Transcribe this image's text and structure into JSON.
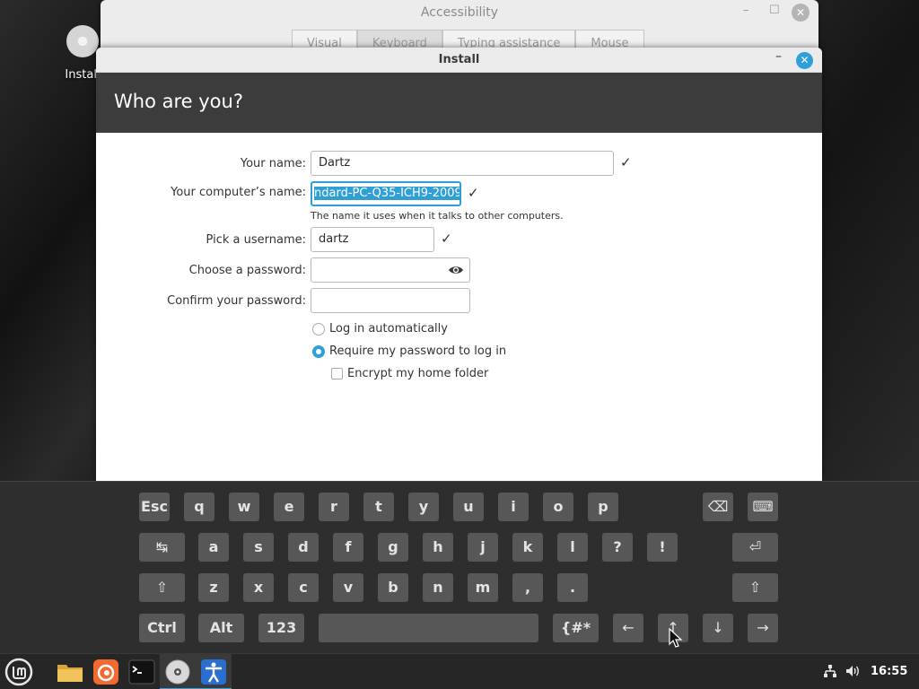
{
  "desktop": {
    "icon_label": "Install"
  },
  "accessibility": {
    "title": "Accessibility",
    "tabs": [
      "Visual",
      "Keyboard",
      "Typing assistance",
      "Mouse"
    ],
    "active_tab": "Keyboard"
  },
  "install": {
    "title": "Install",
    "heading": "Who are you?",
    "form": {
      "name_label": "Your name:",
      "name_value": "Dartz",
      "computer_label": "Your computer’s name:",
      "computer_value": "ndard-PC-Q35-ICH9-2009",
      "computer_hint": "The name it uses when it talks to other computers.",
      "username_label": "Pick a username:",
      "username_value": "dartz",
      "password_label": "Choose a password:",
      "password_value": "",
      "confirm_label": "Confirm your password:",
      "confirm_value": "",
      "login_auto": "Log in automatically",
      "login_require": "Require my password to log in",
      "encrypt": "Encrypt my home folder"
    }
  },
  "keyboard": {
    "row1": [
      "Esc",
      "q",
      "w",
      "e",
      "r",
      "t",
      "y",
      "u",
      "i",
      "o",
      "p"
    ],
    "row2": [
      "a",
      "s",
      "d",
      "f",
      "g",
      "h",
      "j",
      "k",
      "l",
      "?",
      "!"
    ],
    "row3": [
      "z",
      "x",
      "c",
      "v",
      "b",
      "n",
      "m",
      ",",
      "."
    ],
    "row4": {
      "ctrl": "Ctrl",
      "alt": "Alt",
      "num": "123",
      "sym": "{#*"
    },
    "backspace": "⌫",
    "keyboard_icon": "⌨",
    "tab": "↹",
    "enter": "⏎",
    "shift": "⇧",
    "left": "←",
    "up": "↑",
    "down": "↓",
    "right": "→"
  },
  "taskbar": {
    "clock": "16:55"
  },
  "colors": {
    "accent": "#2f9fd8",
    "header": "#3c3c3c",
    "keyboard": "#2e2e2e",
    "key": "#575757"
  }
}
